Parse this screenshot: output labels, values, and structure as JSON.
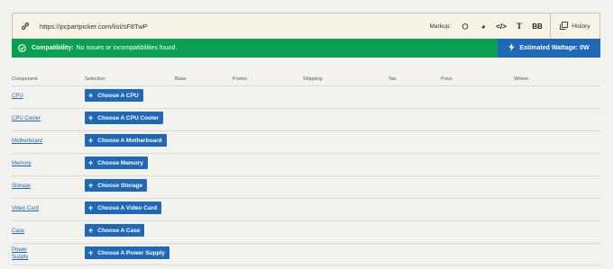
{
  "urlbar": {
    "url": "https://pcpartpicker.com/list/sF8TwP",
    "markup_label": "Markup:",
    "markup_icons": [
      "box-icon",
      "reddit-icon",
      "code-icon",
      "text-icon",
      "bbcode-icon"
    ],
    "markup_glyphs": [
      "⬡",
      "◕",
      "</>",
      "T",
      "BB"
    ],
    "history_label": "History"
  },
  "compat": {
    "label": "Compatibility:",
    "message": "No issues or incompatibilities found."
  },
  "wattage": {
    "label": "Estimated Wattage: 0W"
  },
  "table": {
    "headers": [
      "Component",
      "Selection",
      "Base",
      "Promo",
      "Shipping",
      "Tax",
      "Price",
      "Where"
    ],
    "rows": [
      {
        "component": "CPU",
        "button": "Choose A CPU"
      },
      {
        "component": "CPU Cooler",
        "button": "Choose A CPU Cooler"
      },
      {
        "component": "Motherboard",
        "button": "Choose A Motherboard"
      },
      {
        "component": "Memory",
        "button": "Choose Memory"
      },
      {
        "component": "Storage",
        "button": "Choose Storage"
      },
      {
        "component": "Video Card",
        "button": "Choose A Video Card"
      },
      {
        "component": "Case",
        "button": "Choose A Case"
      },
      {
        "component": "Power Supply",
        "button": "Choose A Power Supply"
      }
    ]
  },
  "colors": {
    "accent": "#1f68b8",
    "success": "#0aa052",
    "background": "#f2f2ee"
  }
}
